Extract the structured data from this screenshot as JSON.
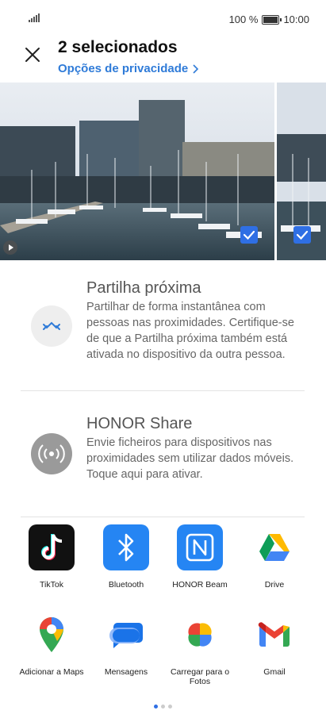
{
  "status_bar": {
    "battery": "100 %",
    "time": "10:00"
  },
  "header": {
    "title": "2 selecionados",
    "privacy_link": "Opções de privacidade"
  },
  "nearby_share": {
    "title": "Partilha próxima",
    "description": "Partilhar de forma instantânea com pessoas nas proximidades. Certifique-se de que a Partilha próxima também está ativada no dispositivo da outra pessoa."
  },
  "honor_share": {
    "title": "HONOR Share",
    "description": "Envie ficheiros para dispositivos nas proximidades sem utilizar dados móveis. Toque aqui para ativar."
  },
  "apps": [
    {
      "label": "TikTok",
      "icon": "tiktok-icon"
    },
    {
      "label": "Bluetooth",
      "icon": "bluetooth-icon"
    },
    {
      "label": "HONOR Beam",
      "icon": "nfc-icon"
    },
    {
      "label": "Drive",
      "icon": "drive-icon"
    },
    {
      "label": "Adicionar a Maps",
      "icon": "maps-icon"
    },
    {
      "label": "Mensagens",
      "icon": "messages-icon"
    },
    {
      "label": "Carregar para o Fotos",
      "icon": "photos-icon"
    },
    {
      "label": "Gmail",
      "icon": "gmail-icon"
    }
  ],
  "colors": {
    "accent": "#2f7bd8",
    "check": "#2f6fe4"
  },
  "pager": {
    "pages": 3,
    "current": 1
  }
}
